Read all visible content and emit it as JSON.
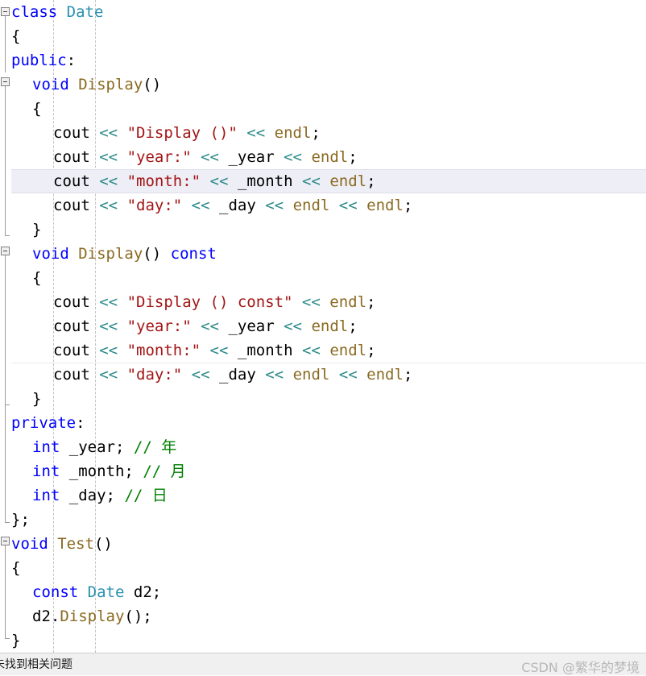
{
  "editor": {
    "language": "C++",
    "colors": {
      "background": "#ffffff",
      "keyword": "#0000ff",
      "type": "#2b91af",
      "function": "#8a6a21",
      "string": "#a31515",
      "operator": "#2e8b8b",
      "comment": "#008000",
      "plain": "#000000",
      "current_line_highlight": "#eeeef6",
      "indent_guide": "#c4c4c4",
      "fold_marker": "#808080"
    },
    "lines": [
      {
        "n": 1,
        "indent": 0,
        "fold": "open",
        "tokens": [
          {
            "t": "class",
            "c": "kw"
          },
          {
            "t": " ",
            "c": "pln"
          },
          {
            "t": "Date",
            "c": "type"
          }
        ]
      },
      {
        "n": 2,
        "indent": 0,
        "tokens": [
          {
            "t": "{",
            "c": "pln"
          }
        ]
      },
      {
        "n": 3,
        "indent": 0,
        "tokens": [
          {
            "t": "public",
            "c": "kw"
          },
          {
            "t": ":",
            "c": "pln"
          }
        ]
      },
      {
        "n": 4,
        "indent": 1,
        "fold": "open",
        "tokens": [
          {
            "t": "void",
            "c": "kw"
          },
          {
            "t": " ",
            "c": "pln"
          },
          {
            "t": "Display",
            "c": "fn"
          },
          {
            "t": "()",
            "c": "pln"
          }
        ]
      },
      {
        "n": 5,
        "indent": 1,
        "tokens": [
          {
            "t": "{",
            "c": "pln"
          }
        ]
      },
      {
        "n": 6,
        "indent": 2,
        "tokens": [
          {
            "t": "cout",
            "c": "pln"
          },
          {
            "t": " ",
            "c": "pln"
          },
          {
            "t": "<<",
            "c": "op"
          },
          {
            "t": " ",
            "c": "pln"
          },
          {
            "t": "\"Display ()\"",
            "c": "str"
          },
          {
            "t": " ",
            "c": "pln"
          },
          {
            "t": "<<",
            "c": "op"
          },
          {
            "t": " ",
            "c": "pln"
          },
          {
            "t": "endl",
            "c": "id"
          },
          {
            "t": ";",
            "c": "pln"
          }
        ]
      },
      {
        "n": 7,
        "indent": 2,
        "tokens": [
          {
            "t": "cout",
            "c": "pln"
          },
          {
            "t": " ",
            "c": "pln"
          },
          {
            "t": "<<",
            "c": "op"
          },
          {
            "t": " ",
            "c": "pln"
          },
          {
            "t": "\"year:\"",
            "c": "str"
          },
          {
            "t": " ",
            "c": "pln"
          },
          {
            "t": "<<",
            "c": "op"
          },
          {
            "t": " ",
            "c": "pln"
          },
          {
            "t": "_year",
            "c": "pln"
          },
          {
            "t": " ",
            "c": "pln"
          },
          {
            "t": "<<",
            "c": "op"
          },
          {
            "t": " ",
            "c": "pln"
          },
          {
            "t": "endl",
            "c": "id"
          },
          {
            "t": ";",
            "c": "pln"
          }
        ]
      },
      {
        "n": 8,
        "indent": 2,
        "highlight": true,
        "tokens": [
          {
            "t": "cout",
            "c": "pln"
          },
          {
            "t": " ",
            "c": "pln"
          },
          {
            "t": "<<",
            "c": "op"
          },
          {
            "t": " ",
            "c": "pln"
          },
          {
            "t": "\"month:\"",
            "c": "str"
          },
          {
            "t": " ",
            "c": "pln"
          },
          {
            "t": "<<",
            "c": "op"
          },
          {
            "t": " ",
            "c": "pln"
          },
          {
            "t": "_month",
            "c": "pln"
          },
          {
            "t": " ",
            "c": "pln"
          },
          {
            "t": "<<",
            "c": "op"
          },
          {
            "t": " ",
            "c": "pln"
          },
          {
            "t": "endl",
            "c": "id"
          },
          {
            "t": ";",
            "c": "pln"
          }
        ]
      },
      {
        "n": 9,
        "indent": 2,
        "tokens": [
          {
            "t": "cout",
            "c": "pln"
          },
          {
            "t": " ",
            "c": "pln"
          },
          {
            "t": "<<",
            "c": "op"
          },
          {
            "t": " ",
            "c": "pln"
          },
          {
            "t": "\"day:\"",
            "c": "str"
          },
          {
            "t": " ",
            "c": "pln"
          },
          {
            "t": "<<",
            "c": "op"
          },
          {
            "t": " ",
            "c": "pln"
          },
          {
            "t": "_day",
            "c": "pln"
          },
          {
            "t": " ",
            "c": "pln"
          },
          {
            "t": "<<",
            "c": "op"
          },
          {
            "t": " ",
            "c": "pln"
          },
          {
            "t": "endl",
            "c": "id"
          },
          {
            "t": " ",
            "c": "pln"
          },
          {
            "t": "<<",
            "c": "op"
          },
          {
            "t": " ",
            "c": "pln"
          },
          {
            "t": "endl",
            "c": "id"
          },
          {
            "t": ";",
            "c": "pln"
          }
        ]
      },
      {
        "n": 10,
        "indent": 1,
        "tokens": [
          {
            "t": "}",
            "c": "pln"
          }
        ]
      },
      {
        "n": 11,
        "indent": 1,
        "fold": "open",
        "tokens": [
          {
            "t": "void",
            "c": "kw"
          },
          {
            "t": " ",
            "c": "pln"
          },
          {
            "t": "Display",
            "c": "fn"
          },
          {
            "t": "()",
            "c": "pln"
          },
          {
            "t": " ",
            "c": "pln"
          },
          {
            "t": "const",
            "c": "kw"
          }
        ]
      },
      {
        "n": 12,
        "indent": 1,
        "tokens": [
          {
            "t": "{",
            "c": "pln"
          }
        ]
      },
      {
        "n": 13,
        "indent": 2,
        "tokens": [
          {
            "t": "cout",
            "c": "pln"
          },
          {
            "t": " ",
            "c": "pln"
          },
          {
            "t": "<<",
            "c": "op"
          },
          {
            "t": " ",
            "c": "pln"
          },
          {
            "t": "\"Display () const\"",
            "c": "str"
          },
          {
            "t": " ",
            "c": "pln"
          },
          {
            "t": "<<",
            "c": "op"
          },
          {
            "t": " ",
            "c": "pln"
          },
          {
            "t": "endl",
            "c": "id"
          },
          {
            "t": ";",
            "c": "pln"
          }
        ]
      },
      {
        "n": 14,
        "indent": 2,
        "tokens": [
          {
            "t": "cout",
            "c": "pln"
          },
          {
            "t": " ",
            "c": "pln"
          },
          {
            "t": "<<",
            "c": "op"
          },
          {
            "t": " ",
            "c": "pln"
          },
          {
            "t": "\"year:\"",
            "c": "str"
          },
          {
            "t": " ",
            "c": "pln"
          },
          {
            "t": "<<",
            "c": "op"
          },
          {
            "t": " ",
            "c": "pln"
          },
          {
            "t": "_year",
            "c": "pln"
          },
          {
            "t": " ",
            "c": "pln"
          },
          {
            "t": "<<",
            "c": "op"
          },
          {
            "t": " ",
            "c": "pln"
          },
          {
            "t": "endl",
            "c": "id"
          },
          {
            "t": ";",
            "c": "pln"
          }
        ]
      },
      {
        "n": 15,
        "indent": 2,
        "tokens": [
          {
            "t": "cout",
            "c": "pln"
          },
          {
            "t": " ",
            "c": "pln"
          },
          {
            "t": "<<",
            "c": "op"
          },
          {
            "t": " ",
            "c": "pln"
          },
          {
            "t": "\"month:\"",
            "c": "str"
          },
          {
            "t": " ",
            "c": "pln"
          },
          {
            "t": "<<",
            "c": "op"
          },
          {
            "t": " ",
            "c": "pln"
          },
          {
            "t": "_month",
            "c": "pln"
          },
          {
            "t": " ",
            "c": "pln"
          },
          {
            "t": "<<",
            "c": "op"
          },
          {
            "t": " ",
            "c": "pln"
          },
          {
            "t": "endl",
            "c": "id"
          },
          {
            "t": ";",
            "c": "pln"
          }
        ]
      },
      {
        "n": 16,
        "indent": 2,
        "separator": true,
        "tokens": [
          {
            "t": "cout",
            "c": "pln"
          },
          {
            "t": " ",
            "c": "pln"
          },
          {
            "t": "<<",
            "c": "op"
          },
          {
            "t": " ",
            "c": "pln"
          },
          {
            "t": "\"day:\"",
            "c": "str"
          },
          {
            "t": " ",
            "c": "pln"
          },
          {
            "t": "<<",
            "c": "op"
          },
          {
            "t": " ",
            "c": "pln"
          },
          {
            "t": "_day",
            "c": "pln"
          },
          {
            "t": " ",
            "c": "pln"
          },
          {
            "t": "<<",
            "c": "op"
          },
          {
            "t": " ",
            "c": "pln"
          },
          {
            "t": "endl",
            "c": "id"
          },
          {
            "t": " ",
            "c": "pln"
          },
          {
            "t": "<<",
            "c": "op"
          },
          {
            "t": " ",
            "c": "pln"
          },
          {
            "t": "endl",
            "c": "id"
          },
          {
            "t": ";",
            "c": "pln"
          }
        ]
      },
      {
        "n": 17,
        "indent": 1,
        "tokens": [
          {
            "t": "}",
            "c": "pln"
          }
        ]
      },
      {
        "n": 18,
        "indent": 0,
        "tokens": [
          {
            "t": "private",
            "c": "kw"
          },
          {
            "t": ":",
            "c": "pln"
          }
        ]
      },
      {
        "n": 19,
        "indent": 1,
        "tokens": [
          {
            "t": "int",
            "c": "kw"
          },
          {
            "t": " ",
            "c": "pln"
          },
          {
            "t": "_year",
            "c": "pln"
          },
          {
            "t": "; ",
            "c": "pln"
          },
          {
            "t": "// ",
            "c": "cmt"
          },
          {
            "t": "年",
            "c": "cmt cjk"
          }
        ]
      },
      {
        "n": 20,
        "indent": 1,
        "tokens": [
          {
            "t": "int",
            "c": "kw"
          },
          {
            "t": " ",
            "c": "pln"
          },
          {
            "t": "_month",
            "c": "pln"
          },
          {
            "t": "; ",
            "c": "pln"
          },
          {
            "t": "// ",
            "c": "cmt"
          },
          {
            "t": "月",
            "c": "cmt cjk"
          }
        ]
      },
      {
        "n": 21,
        "indent": 1,
        "tokens": [
          {
            "t": "int",
            "c": "kw"
          },
          {
            "t": " ",
            "c": "pln"
          },
          {
            "t": "_day",
            "c": "pln"
          },
          {
            "t": "; ",
            "c": "pln"
          },
          {
            "t": "// ",
            "c": "cmt"
          },
          {
            "t": "日",
            "c": "cmt cjk"
          }
        ]
      },
      {
        "n": 22,
        "indent": 0,
        "tokens": [
          {
            "t": "};",
            "c": "pln"
          }
        ]
      },
      {
        "n": 23,
        "indent": 0,
        "fold": "open",
        "tokens": [
          {
            "t": "void",
            "c": "kw"
          },
          {
            "t": " ",
            "c": "pln"
          },
          {
            "t": "Test",
            "c": "fn"
          },
          {
            "t": "()",
            "c": "pln"
          }
        ]
      },
      {
        "n": 24,
        "indent": 0,
        "tokens": [
          {
            "t": "{",
            "c": "pln"
          }
        ]
      },
      {
        "n": 25,
        "indent": 1,
        "tokens": [
          {
            "t": "const",
            "c": "kw"
          },
          {
            "t": " ",
            "c": "pln"
          },
          {
            "t": "Date",
            "c": "type"
          },
          {
            "t": " ",
            "c": "pln"
          },
          {
            "t": "d2",
            "c": "pln"
          },
          {
            "t": ";",
            "c": "pln"
          }
        ]
      },
      {
        "n": 26,
        "indent": 1,
        "tokens": [
          {
            "t": "d2",
            "c": "pln"
          },
          {
            "t": ".",
            "c": "pln"
          },
          {
            "t": "Display",
            "c": "fn"
          },
          {
            "t": "();",
            "c": "pln"
          }
        ]
      },
      {
        "n": 27,
        "indent": 0,
        "tokens": [
          {
            "t": "}",
            "c": "pln"
          }
        ]
      }
    ],
    "fold_markers": [
      {
        "name": "fold-marker-class-date",
        "line": 1
      },
      {
        "name": "fold-marker-display",
        "line": 4
      },
      {
        "name": "fold-marker-display-const",
        "line": 11
      },
      {
        "name": "fold-marker-test",
        "line": 23
      }
    ]
  },
  "statusbar": {
    "message": "未找到相关问题",
    "watermark": "CSDN @繁华的梦境"
  }
}
